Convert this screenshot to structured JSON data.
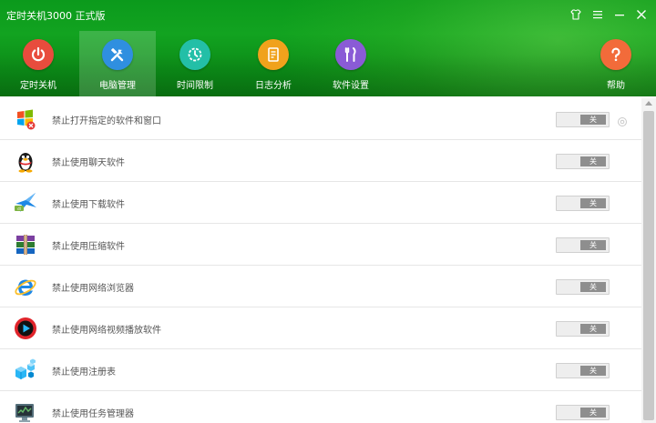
{
  "app": {
    "title": "定时关机3000 正式版"
  },
  "window_controls": [
    {
      "name": "skin-icon"
    },
    {
      "name": "menu-icon"
    },
    {
      "name": "minimize-icon"
    },
    {
      "name": "close-icon"
    }
  ],
  "nav": {
    "items": [
      {
        "label": "定时关机",
        "icon": "power-icon",
        "color": "#e84c3d"
      },
      {
        "label": "电脑管理",
        "icon": "tools-icon",
        "color": "#2f8fe0",
        "active": true
      },
      {
        "label": "时间限制",
        "icon": "clock-icon",
        "color": "#23bfa7"
      },
      {
        "label": "日志分析",
        "icon": "log-icon",
        "color": "#f0a21c"
      },
      {
        "label": "软件设置",
        "icon": "settings-icon",
        "color": "#8a5bd6"
      }
    ],
    "help": {
      "label": "帮助",
      "icon": "help-icon",
      "color": "#f26b3a"
    }
  },
  "rules": [
    {
      "label": "禁止打开指定的软件和窗口",
      "icon": "windows-app-icon",
      "toggle": "关"
    },
    {
      "label": "禁止使用聊天软件",
      "icon": "qq-penguin-icon",
      "toggle": "关"
    },
    {
      "label": "禁止使用下载软件",
      "icon": "download-bird-icon",
      "toggle": "关"
    },
    {
      "label": "禁止使用压缩软件",
      "icon": "archive-books-icon",
      "toggle": "关"
    },
    {
      "label": "禁止使用网络浏览器",
      "icon": "ie-browser-icon",
      "toggle": "关"
    },
    {
      "label": "禁止使用网络视频播放软件",
      "icon": "video-player-icon",
      "toggle": "关"
    },
    {
      "label": "禁止使用注册表",
      "icon": "registry-cubes-icon",
      "toggle": "关"
    },
    {
      "label": "禁止使用任务管理器",
      "icon": "task-manager-icon",
      "toggle": "关"
    }
  ]
}
